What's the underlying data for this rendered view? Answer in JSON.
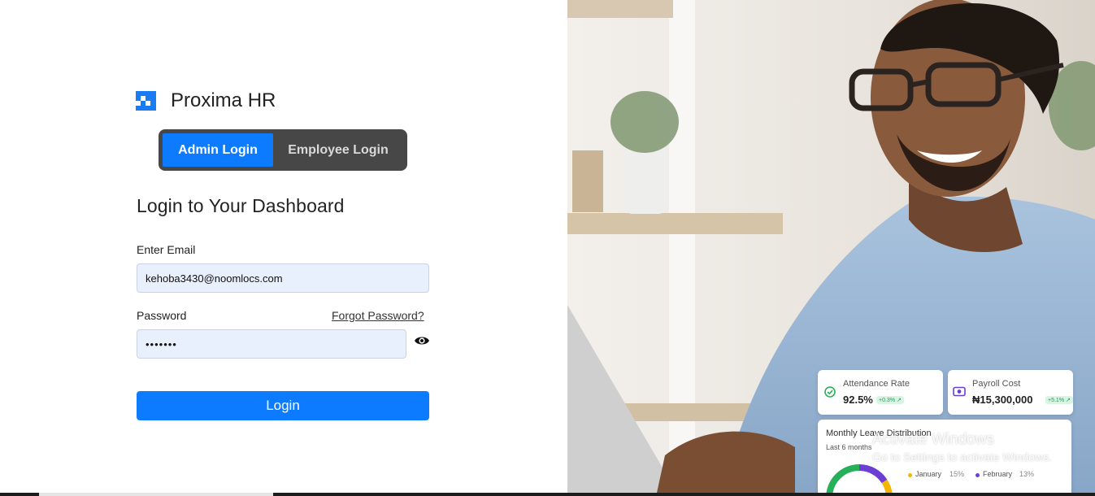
{
  "brand": {
    "name": "Proxima HR"
  },
  "tabs": {
    "admin": "Admin Login",
    "employee": "Employee Login",
    "active": "admin"
  },
  "form": {
    "heading": "Login to Your Dashboard",
    "email_label": "Enter Email",
    "email_value": "kehoba3430@noomlocs.com",
    "password_label": "Password",
    "password_value": "•••••••",
    "forgot": "Forgot Password?",
    "login_button": "Login"
  },
  "hero": {
    "attendance": {
      "title": "Attendance Rate",
      "value": "92.5%",
      "badge": "+0.3% ↗"
    },
    "payroll": {
      "title": "Payroll Cost",
      "value": "₦15,300,000",
      "badge": "+5.1% ↗"
    },
    "leave": {
      "title": "Monthly Leave Distribution",
      "subtitle": "Last 6 months",
      "legend": [
        {
          "label": "January",
          "value": "15%",
          "color": "#f5b400"
        },
        {
          "label": "February",
          "value": "13%",
          "color": "#6b3fd3"
        }
      ]
    }
  },
  "watermark": {
    "title": "Activate Windows",
    "subtitle": "Go to Settings to activate Windows."
  },
  "colors": {
    "primary": "#0d7bff",
    "tab_bg": "#474747",
    "input_bg": "#e8f0fe"
  },
  "icons": {
    "logo": "brand-logo-icon",
    "eye": "eye-icon",
    "check": "check-circle-icon",
    "money": "money-icon"
  }
}
